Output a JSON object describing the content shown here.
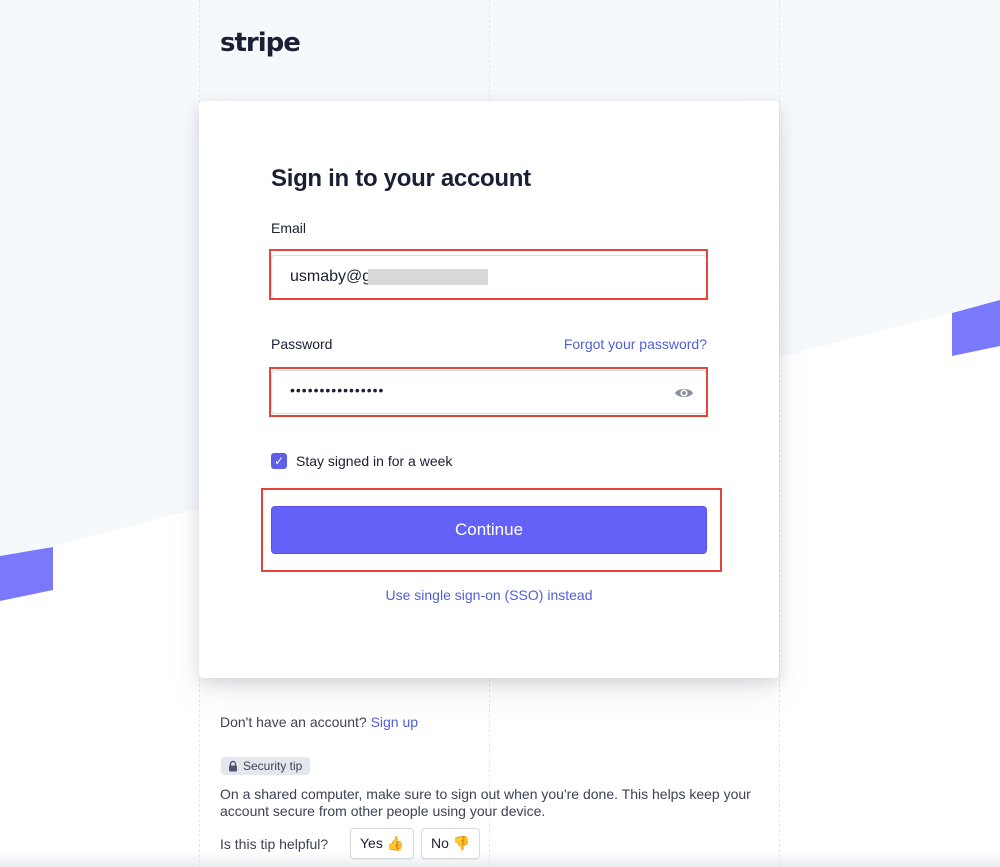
{
  "brand": {
    "logo_text": "stripe",
    "accent_color": "#635bff",
    "highlight_color": "#e5443a"
  },
  "signin": {
    "title": "Sign in to your account",
    "email": {
      "label": "Email",
      "value": "usmaby@g"
    },
    "password": {
      "label": "Password",
      "masked_value": "••••••••••••••••",
      "forgot_link": "Forgot your password?",
      "toggle_icon": "eye-icon"
    },
    "stay_signed_in": {
      "label": "Stay signed in for a week",
      "checked": true
    },
    "continue_label": "Continue",
    "sso_link": "Use single sign-on (SSO) instead"
  },
  "footer": {
    "no_account_text": "Don't have an account?",
    "signup_link": "Sign up",
    "security_tip": {
      "badge": "Security tip",
      "icon": "lock-icon",
      "text": "On a shared computer, make sure to sign out when you're done. This helps keep your account secure from other people using your device.",
      "question": "Is this tip helpful?",
      "yes_label": "Yes 👍",
      "no_label": "No 👎"
    }
  }
}
